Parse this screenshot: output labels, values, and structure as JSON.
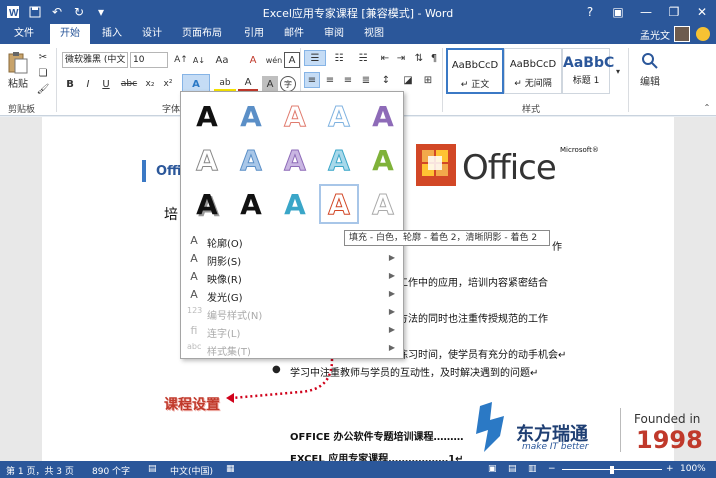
{
  "titlebar": {
    "title": "Excel应用专家课程 [兼容模式] - Word",
    "qat_icons": [
      "word-app-icon",
      "save-icon",
      "undo-icon",
      "redo-icon",
      "customize-qat-icon"
    ],
    "win_icons": [
      "help-icon",
      "ribbon-options-icon",
      "minimize-icon",
      "restore-icon",
      "close-icon"
    ]
  },
  "tabs": {
    "file": "文件",
    "items": [
      "开始",
      "插入",
      "设计",
      "页面布局",
      "引用",
      "邮件",
      "审阅",
      "视图"
    ],
    "user": "孟光文"
  },
  "ribbon": {
    "paste_label": "粘贴",
    "clipboard_label": "剪贴板",
    "font_name": "微软雅黑 (中文",
    "font_size": "10",
    "font_group_label": "字体",
    "styles_label": "样式",
    "edit_label": "编辑",
    "styles": [
      {
        "sample": "AaBbCcD",
        "name": "↵ 正文"
      },
      {
        "sample": "AaBbCcD",
        "name": "↵ 无间隔"
      },
      {
        "sample": "AaBbC",
        "name": "标题 1"
      }
    ],
    "glyphs": {
      "bold": "B",
      "italic": "I",
      "underline": "U",
      "strike": "abc",
      "sub": "x₂",
      "sup": "x²",
      "grow": "A↑",
      "shrink": "A↓",
      "case": "Aa",
      "clear": "A",
      "phonetic": "wén",
      "border": "A",
      "effect": "A",
      "highlight": "ab",
      "fontcolor": "A",
      "shade": "A",
      "enclose": "字"
    }
  },
  "effects_menu": {
    "items": [
      {
        "label": "轮廓(O)",
        "icon": "A",
        "arrow": false,
        "disabled": false
      },
      {
        "label": "阴影(S)",
        "icon": "A",
        "arrow": true,
        "disabled": false
      },
      {
        "label": "映像(R)",
        "icon": "A",
        "arrow": true,
        "disabled": false
      },
      {
        "label": "发光(G)",
        "icon": "A",
        "arrow": true,
        "disabled": false
      },
      {
        "label": "编号样式(N)",
        "icon": "123",
        "arrow": true,
        "disabled": true
      },
      {
        "label": "连字(L)",
        "icon": "fi",
        "arrow": true,
        "disabled": true
      },
      {
        "label": "样式集(T)",
        "icon": "abc",
        "arrow": true,
        "disabled": true
      }
    ],
    "gallery_letter": "A"
  },
  "tooltip": "填充 - 白色，轮廓 - 着色 2，清晰阴影 - 着色 2",
  "document": {
    "heading_prefix": "Offi",
    "heading2": "培",
    "lines": [
      "作",
      "工作中的应用，培训内容紧密结合",
      "方法的同时也注重传授规范的工作",
      "练习时间，使学员有充分的动手机会↵",
      "学习中注重教师与学员的互动性，及时解决遇到的问题↵"
    ],
    "course_setting": "课程设置",
    "toc1": "OFFICE 办公软件专题培训课程………",
    "toc2": "EXCEL 应用专家课程………………1↵"
  },
  "office_logo": {
    "microsoft": "Microsoft®",
    "office": "Office"
  },
  "watermark": {
    "brand": "东方瑞通",
    "slogan": "make IT better",
    "founded": "Founded in",
    "year": "1998"
  },
  "status": {
    "page": "第 1 页，共 3 页",
    "words": "890 个字",
    "lang": "中文(中国)",
    "zoom": "100%"
  },
  "colors": {
    "accent": "#2b579a",
    "red": "#c0392b"
  }
}
